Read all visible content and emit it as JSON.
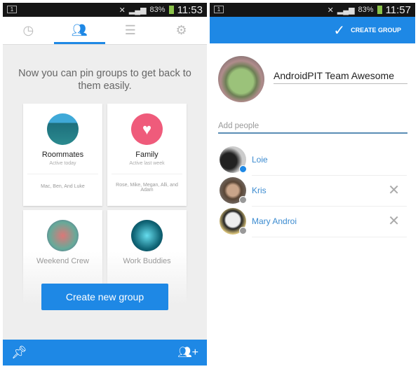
{
  "left": {
    "status": {
      "battery": "83%",
      "time": "11:53"
    },
    "tabs": [
      {
        "icon": "clock-icon"
      },
      {
        "icon": "groups-icon",
        "active": true
      },
      {
        "icon": "list-icon"
      },
      {
        "icon": "gear-icon"
      }
    ],
    "message": "Now you can pin groups to get back to them easily.",
    "groups": [
      {
        "name": "Roommates",
        "activity": "Active today",
        "members": "Mac, Ben, And Luke"
      },
      {
        "name": "Family",
        "activity": "Active last week",
        "members": "Rose, Mike, Megan, Alli, and Adam"
      },
      {
        "name": "Weekend Crew"
      },
      {
        "name": "Work Buddies"
      }
    ],
    "create_button": "Create new group",
    "accent": "#1e88e5"
  },
  "right": {
    "status": {
      "battery": "83%",
      "time": "11:57"
    },
    "create_group": "CREATE GROUP",
    "group_name": "AndroidPIT Team Awesome",
    "add_people_placeholder": "Add people",
    "people": [
      {
        "name": "Loie",
        "badge": "messenger"
      },
      {
        "name": "Kris",
        "badge": "facebook"
      },
      {
        "name": "Mary Androi",
        "badge": "facebook"
      }
    ]
  }
}
